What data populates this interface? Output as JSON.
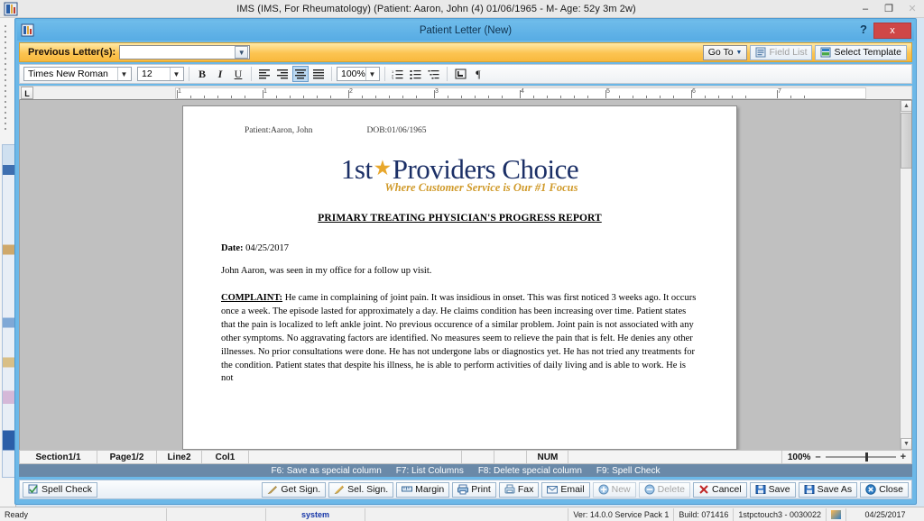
{
  "os_window": {
    "title": "IMS (IMS, For Rheumatology)   (Patient: Aaron, John  (4) 01/06/1965 - M- Age: 52y 3m 2w)",
    "minimize_label": "–",
    "restore_label": "❐",
    "close_label": "✕",
    "app_icon": "ims-app-icon"
  },
  "child_window": {
    "title": "Patient Letter (New)",
    "help_label": "?",
    "close_label": "x",
    "icon": "ims-app-icon"
  },
  "previous_letters": {
    "label": "Previous Letter(s):",
    "value": "",
    "placeholder": "",
    "dropdown_arrow": "chevron-down-icon",
    "go_to_label": "Go To",
    "field_list_label": "Field List",
    "select_template_label": "Select Template"
  },
  "format_toolbar": {
    "font_family": "Times New Roman",
    "font_size": "12",
    "zoom": "100%",
    "bold_label": "B",
    "italic_label": "I",
    "underline_label": "U",
    "align_left": "align-left-icon",
    "align_right": "align-right-icon",
    "align_center": "align-center-icon",
    "align_justify": "align-justify-icon",
    "numbered_list": "numbered-list-icon",
    "bulleted_list": "bulleted-list-icon",
    "multilevel_list": "multilevel-list-icon",
    "insert_box": "insert-box-icon",
    "pilcrow": "¶"
  },
  "ruler": {
    "tab_selector": "L",
    "marks": [
      "1",
      "1",
      "2",
      "3",
      "4",
      "5",
      "6",
      "7"
    ]
  },
  "document": {
    "header_patient": "Patient:Aaron, John",
    "header_dob": "DOB:01/06/1965",
    "logo_first": "1st",
    "logo_star": "★",
    "logo_rest": "Providers Choice",
    "logo_tagline": "Where Customer Service is Our #1 Focus",
    "title": "PRIMARY TREATING PHYSICIAN'S PROGRESS REPORT",
    "date_label": "Date:",
    "date_value": "04/25/2017",
    "intro": "John Aaron,  was seen in my office for a follow up visit.",
    "complaint_label": "COMPLAINT:",
    "complaint_text": " He came in complaining of joint pain. It was insidious in onset. This was first noticed 3 weeks ago. It occurs once a week. The episode lasted for approximately a day. He claims condition has been increasing over time. Patient states that the pain is localized to left ankle joint. No previous occurence of a similar problem. Joint pain is not associated with any other symptoms. No aggravating factors are identified. No measures seem to relieve the pain that is felt. He denies any other illnesses. No prior consultations were done. He has not undergone labs or diagnostics yet. He has not tried any treatments for the condition. Patient states that despite his illness, he is able to perform activities of daily living and is able to work. He is not"
  },
  "doc_status": {
    "section": "Section1/1",
    "page": "Page1/2",
    "line": "Line2",
    "col": "Col1",
    "num_lock": "NUM",
    "zoom_value": "100%",
    "zoom_minus": "–",
    "zoom_plus": "+"
  },
  "fkey_hints": [
    "F6: Save as special column",
    "F7: List Columns",
    "F8: Delete special column",
    "F9:  Spell Check"
  ],
  "action_bar": {
    "spell_check": "Spell Check",
    "get_sign": "Get Sign.",
    "sel_sign": "Sel. Sign.",
    "margin": "Margin",
    "print": "Print",
    "fax": "Fax",
    "email": "Email",
    "new": "New",
    "delete": "Delete",
    "cancel": "Cancel",
    "save": "Save",
    "save_as": "Save As",
    "close": "Close"
  },
  "status_bar": {
    "ready": "Ready",
    "blank1": "",
    "user": "system",
    "blank2": "",
    "version": "Ver: 14.0.0 Service Pack 1",
    "build": "Build: 071416",
    "machine": "1stpctouch3 - 0030022",
    "tray_icon": "tray-icon",
    "date": "04/25/2017"
  },
  "colors": {
    "title_blue": "#57ace4",
    "gold": "#fcc451",
    "close_red": "#cf4747",
    "logo_navy": "#1b2f66",
    "logo_gold": "#d09a2a",
    "fkey_bar": "#6a89a8"
  }
}
